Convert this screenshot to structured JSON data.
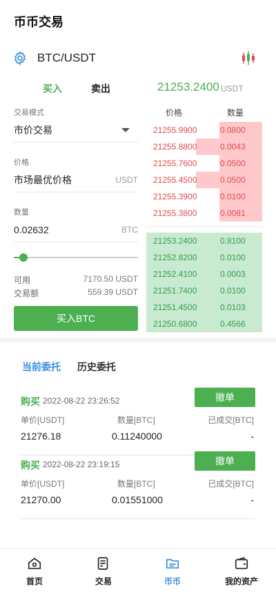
{
  "header": {
    "title": "币币交易"
  },
  "pair": {
    "name": "BTC/USDT",
    "icon": "gear-icon",
    "chart_icon": "candlestick-icon"
  },
  "trade_tabs": {
    "buy": "买入",
    "sell": "卖出"
  },
  "last_price": {
    "value": "21253.2400",
    "unit": "USDT"
  },
  "form": {
    "mode_label": "交易模式",
    "mode_value": "市价交易",
    "price_label": "价格",
    "price_value": "市场最优价格",
    "price_unit": "USDT",
    "qty_label": "数量",
    "qty_value": "0.02632",
    "qty_unit": "BTC",
    "slider_fraction": 0.08,
    "available_label": "可用",
    "available_value": "7170.50 USDT",
    "amount_label": "交易额",
    "amount_value": "559.39 USDT",
    "submit_label": "买入BTC"
  },
  "order_book": {
    "price_header": "价格",
    "qty_header": "数量",
    "asks": [
      {
        "price": "21255.9900",
        "qty": "0.0800",
        "depth": 0.37
      },
      {
        "price": "21255.8800",
        "qty": "0.0043",
        "depth": 0.57
      },
      {
        "price": "21255.7600",
        "qty": "0.0500",
        "depth": 0.37
      },
      {
        "price": "21255.4500",
        "qty": "0.0500",
        "depth": 0.57
      },
      {
        "price": "21255.3900",
        "qty": "0.0100",
        "depth": 0.37
      },
      {
        "price": "21255.3800",
        "qty": "0.0081",
        "depth": 0.37
      }
    ],
    "bids": [
      {
        "price": "21253.2400",
        "qty": "0.8100",
        "depth": 1.0
      },
      {
        "price": "21252.8200",
        "qty": "0.0100",
        "depth": 1.0
      },
      {
        "price": "21252.4100",
        "qty": "0.0003",
        "depth": 1.0
      },
      {
        "price": "21251.7400",
        "qty": "0.0100",
        "depth": 1.0
      },
      {
        "price": "21251.4500",
        "qty": "0.0103",
        "depth": 1.0
      },
      {
        "price": "21250.6800",
        "qty": "0.4566",
        "depth": 0.57
      }
    ],
    "ask_color": "#ffc9cc",
    "bid_color": "#c7ead0"
  },
  "order_tabs": {
    "current": "当前委托",
    "history": "历史委托"
  },
  "orders": [
    {
      "side": "购买",
      "time": "2022-08-22 23:26:52",
      "cancel": "撤单",
      "price_header": "单价[USDT]",
      "qty_header": "数量[BTC]",
      "filled_header": "已成交[BTC]",
      "price": "21276.18",
      "qty": "0.11240000",
      "filled": "-"
    },
    {
      "side": "购买",
      "time": "2022-08-22 23:19:15",
      "cancel": "撤单",
      "price_header": "单价[USDT]",
      "qty_header": "数量[BTC]",
      "filled_header": "已成交[BTC]",
      "price": "21270.00",
      "qty": "0.01551000",
      "filled": "-"
    }
  ],
  "nav": [
    {
      "label": "首页",
      "icon": "home-icon"
    },
    {
      "label": "交易",
      "icon": "trade-icon"
    },
    {
      "label": "币币",
      "icon": "coin-icon",
      "active": true
    },
    {
      "label": "我的资产",
      "icon": "wallet-icon"
    }
  ],
  "colors": {
    "green": "#4caf50",
    "blue": "#3a8dde",
    "red": "#e04a4a"
  }
}
